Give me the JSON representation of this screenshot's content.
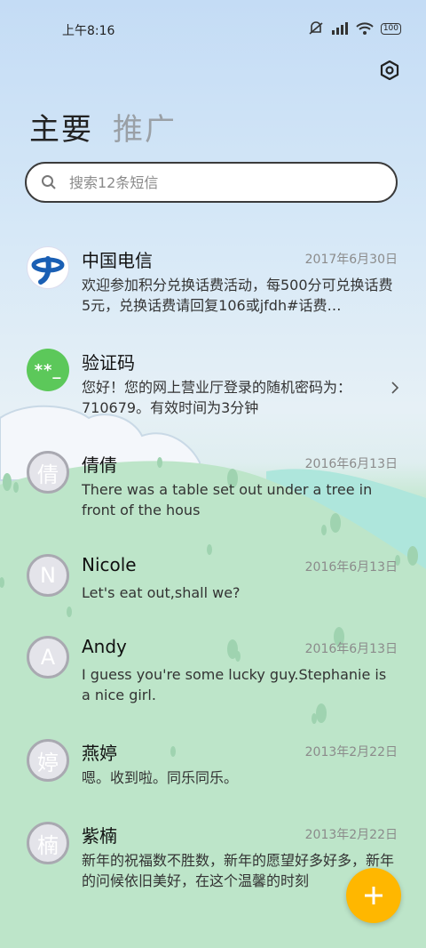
{
  "status_bar": {
    "time": "上午8:16",
    "battery": "100",
    "icons": [
      "mute-icon",
      "signal-icon",
      "wifi-icon",
      "battery-icon"
    ]
  },
  "header": {
    "settings_icon": "gear-icon"
  },
  "tabs": [
    {
      "label": "主要",
      "active": true
    },
    {
      "label": "推广",
      "active": false
    }
  ],
  "search": {
    "placeholder": "搜索12条短信"
  },
  "conversations": [
    {
      "name": "中国电信",
      "date": "2017年6月30日",
      "preview": "欢迎参加积分兑换话费活动，每500分可兑换话费5元，兑换话费请回复106或jfdh#话费…",
      "avatar": "telecom-logo"
    },
    {
      "name": "验证码",
      "date": "",
      "preview": "您好！您的网上营业厅登录的随机密码为：710679。有效时间为3分钟",
      "avatar_text": "**_"
    },
    {
      "name": "倩倩",
      "date": "2016年6月13日",
      "preview": "There was a table set out under a tree in front of the hous",
      "avatar_text": "倩"
    },
    {
      "name": "Nicole",
      "date": "2016年6月13日",
      "preview": "Let's eat out,shall we?",
      "avatar_text": "N"
    },
    {
      "name": "Andy",
      "date": "2016年6月13日",
      "preview": "I guess you're some lucky guy.Stephanie is a nice girl.",
      "avatar_text": "A"
    },
    {
      "name": "燕婷",
      "date": "2013年2月22日",
      "preview": "嗯。收到啦。同乐同乐。",
      "avatar_text": "婷"
    },
    {
      "name": "紫楠",
      "date": "2013年2月22日",
      "preview": "新年的祝福数不胜数，新年的愿望好多好多，新年的问候依旧美好，在这个温馨的时刻",
      "avatar_text": "楠"
    }
  ],
  "fab": {
    "icon": "plus-icon"
  },
  "colors": {
    "accent": "#ffb700",
    "code_avatar": "#5cc85a",
    "hill": "#b9e4c6"
  }
}
